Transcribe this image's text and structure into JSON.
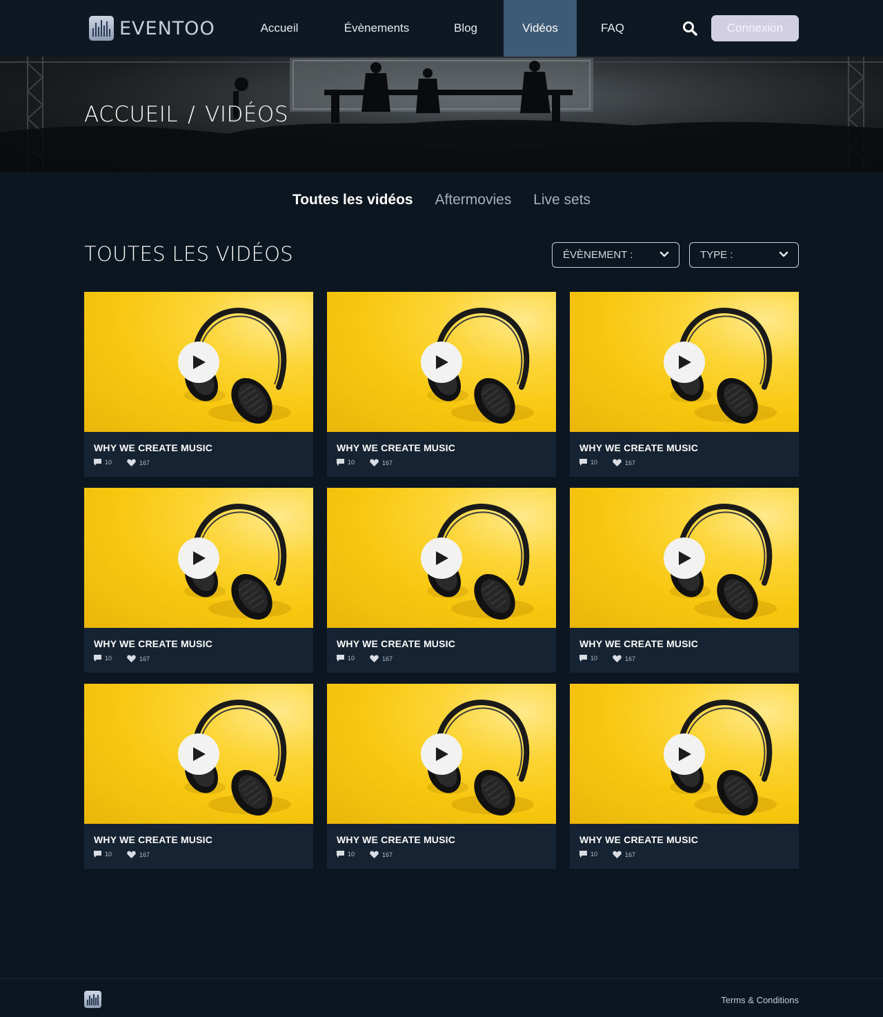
{
  "nav": {
    "brand": "EVENTOO",
    "items": [
      {
        "label": "Accueil"
      },
      {
        "label": "Évènements"
      },
      {
        "label": "Blog"
      },
      {
        "label": "Vidéos"
      },
      {
        "label": "FAQ"
      }
    ],
    "active_item": "Vidéos",
    "login_label": "Connexion"
  },
  "hero": {
    "crumb_home": "ACCUEIL",
    "separator": "/",
    "crumb_current": "VIDÉOS"
  },
  "tabs": [
    {
      "label": "Toutes les vidéos"
    },
    {
      "label": "Aftermovies"
    },
    {
      "label": "Live sets"
    }
  ],
  "active_tab": "Toutes les vidéos",
  "section": {
    "title": "TOUTES LES VIDÉOS",
    "filter_event": "ÉVÈNEMENT :",
    "filter_type": "TYPE :"
  },
  "videos": [
    {
      "title": "WHY WE CREATE MUSIC",
      "comments": "10",
      "likes": "167"
    },
    {
      "title": "WHY WE CREATE MUSIC",
      "comments": "10",
      "likes": "167"
    },
    {
      "title": "WHY WE CREATE MUSIC",
      "comments": "10",
      "likes": "167"
    },
    {
      "title": "WHY WE CREATE MUSIC",
      "comments": "10",
      "likes": "167"
    },
    {
      "title": "WHY WE CREATE MUSIC",
      "comments": "10",
      "likes": "167"
    },
    {
      "title": "WHY WE CREATE MUSIC",
      "comments": "10",
      "likes": "167"
    },
    {
      "title": "WHY WE CREATE MUSIC",
      "comments": "10",
      "likes": "167"
    },
    {
      "title": "WHY WE CREATE MUSIC",
      "comments": "10",
      "likes": "167"
    },
    {
      "title": "WHY WE CREATE MUSIC",
      "comments": "10",
      "likes": "167"
    }
  ],
  "footer": {
    "terms_label": "Terms & Conditions"
  },
  "colors": {
    "background": "#0c1620",
    "nav_active": "#3d5a76",
    "login_button": "#d2cfe3",
    "card": "#152333",
    "thumbnail_yellow": "#f7c70f"
  }
}
